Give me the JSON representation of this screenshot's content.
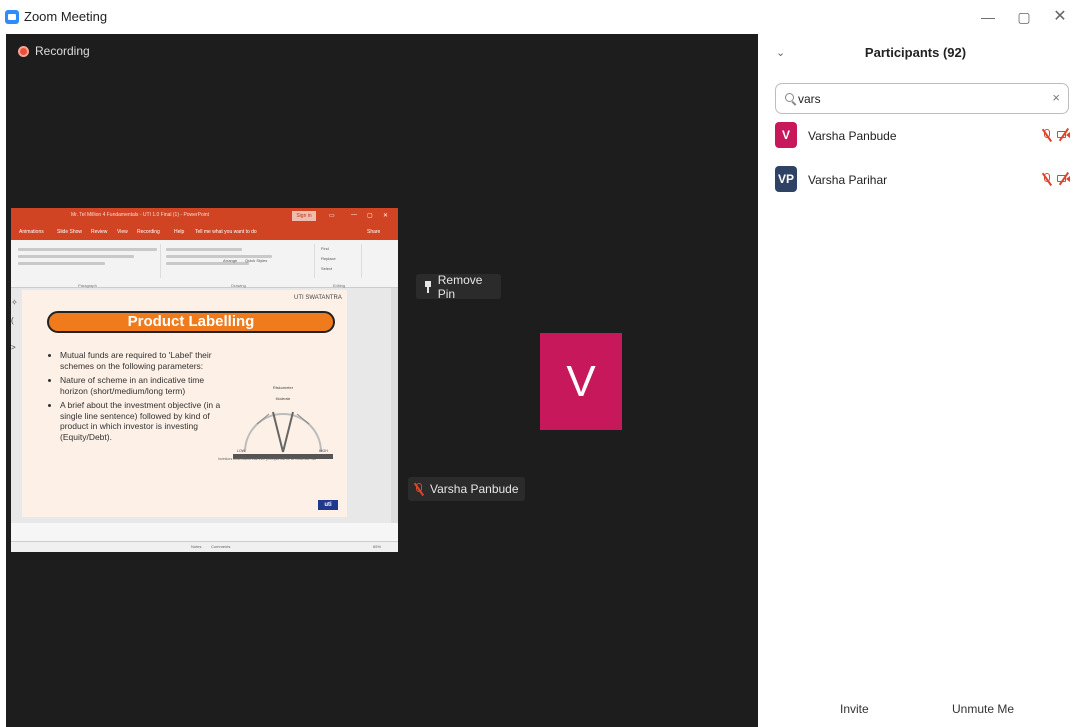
{
  "window": {
    "title": "Zoom Meeting",
    "minimize": "—",
    "maximize": "▢",
    "close": "✕"
  },
  "meeting": {
    "recording_label": "Recording",
    "remove_pin_label": "Remove Pin",
    "speaker_initial": "V",
    "speaker_name": "Varsha Panbude"
  },
  "shared_screen": {
    "ppt_title": "Mr. Tel Million 4 Fundamentals - UTI 1.0 Final (1) - PowerPoint",
    "sign_in": "Sign in",
    "share": "Share",
    "menu": [
      "Animations",
      "Slide Show",
      "Review",
      "View",
      "Recording",
      "Help",
      "Tell me what you want to do"
    ],
    "ribbon_groups": [
      "Paragraph",
      "Drawing",
      "Editing"
    ],
    "ribbon_buttons": [
      "Arrange",
      "Quick Styles",
      "Find",
      "Replace",
      "Select"
    ],
    "slide": {
      "logo": "UTI SWATANTRA",
      "title": "Product Labelling",
      "bullets": [
        "Mutual funds are required to 'Label' their schemes on the following parameters:",
        "Nature of scheme in an indicative time horizon (short/medium/long term)",
        "A brief about the investment objective (in a single line sentence) followed by kind of product in which investor is investing (Equity/Debt)."
      ],
      "meter_title": "Riskometer",
      "meter_mid": "Moderate",
      "meter_low": "LOW",
      "meter_high": "HIGH",
      "meter_caption": "Investors understand that their principal will be at moderate risk",
      "badge": "uti"
    },
    "status": {
      "notes": "Notes",
      "comments": "Comments",
      "zoom": "65%"
    }
  },
  "participants": {
    "title": "Participants (92)",
    "search_value": "vars",
    "list": [
      {
        "initials": "V",
        "name": "Varsha Panbude",
        "color": "#c6185b"
      },
      {
        "initials": "VP",
        "name": "Varsha Parihar",
        "color": "#2e4266"
      }
    ],
    "invite_label": "Invite",
    "unmute_label": "Unmute Me"
  },
  "icons": [
    "zoom-logo-icon",
    "recording-icon",
    "pin-icon",
    "mic-muted-icon",
    "video-muted-icon",
    "search-icon",
    "clear-icon",
    "chevron-down-icon"
  ],
  "colors": {
    "mute_red": "#e2432c",
    "avatar_pink": "#c6185b",
    "avatar_navy": "#2e4266",
    "ppt_orange": "#d04423",
    "slide_banner": "#f07b1d"
  }
}
